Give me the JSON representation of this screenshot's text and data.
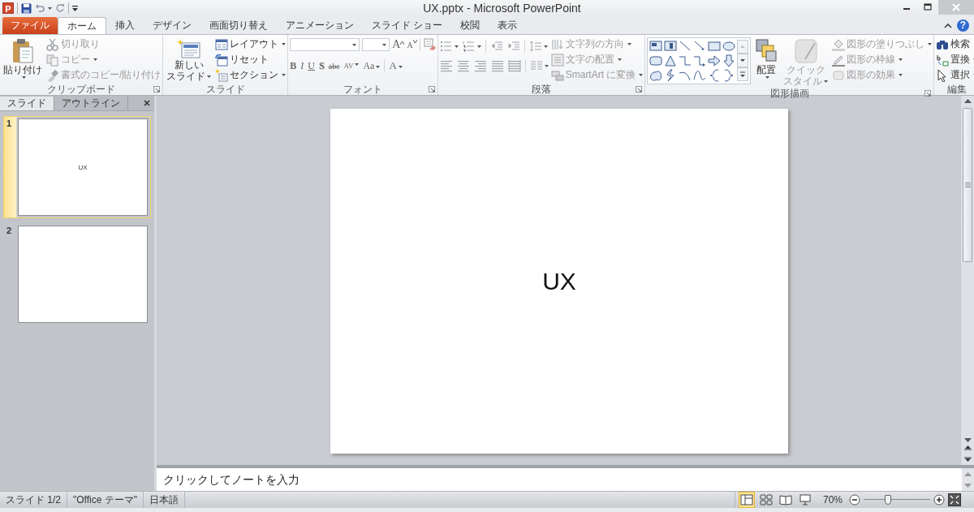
{
  "app_icon": {
    "letter": "P"
  },
  "window": {
    "title": "UX.pptx - Microsoft PowerPoint"
  },
  "tabs": [
    {
      "label": "ファイル",
      "kind": "file",
      "selected": false
    },
    {
      "label": "ホーム",
      "kind": "tab",
      "selected": true
    },
    {
      "label": "挿入",
      "kind": "tab",
      "selected": false
    },
    {
      "label": "デザイン",
      "kind": "tab",
      "selected": false
    },
    {
      "label": "画面切り替え",
      "kind": "tab",
      "selected": false
    },
    {
      "label": "アニメーション",
      "kind": "tab",
      "selected": false
    },
    {
      "label": "スライド ショー",
      "kind": "tab",
      "selected": false
    },
    {
      "label": "校閲",
      "kind": "tab",
      "selected": false
    },
    {
      "label": "表示",
      "kind": "tab",
      "selected": false
    }
  ],
  "help": "?",
  "ribbon": {
    "clipboard": {
      "label": "クリップボード",
      "paste": {
        "label": "貼り付け",
        "dropdown": true
      },
      "items": [
        {
          "label": "切り取り",
          "disabled": true,
          "dropdown": false
        },
        {
          "label": "コピー",
          "disabled": true,
          "dropdown": true
        },
        {
          "label": "書式のコピー/貼り付け",
          "disabled": true,
          "dropdown": false
        }
      ]
    },
    "slides": {
      "label": "スライド",
      "new_slide": {
        "lines": [
          "新しい",
          "スライド"
        ],
        "dropdown": true
      },
      "items": [
        {
          "label": "レイアウト",
          "disabled": false,
          "dropdown": true
        },
        {
          "label": "リセット",
          "disabled": false,
          "dropdown": false
        },
        {
          "label": "セクション",
          "disabled": false,
          "dropdown": true
        }
      ]
    },
    "font": {
      "label": "フォント",
      "size_buttons": [
        {
          "label": "A",
          "kind": "grow"
        },
        {
          "label": "A",
          "kind": "shrink"
        }
      ],
      "format_buttons": [
        {
          "label": "B",
          "kind": "bold",
          "dropdown": false
        },
        {
          "label": "I",
          "kind": "italic",
          "dropdown": false
        },
        {
          "label": "U",
          "kind": "underline",
          "dropdown": false
        },
        {
          "label": "S",
          "kind": "shadow",
          "dropdown": false
        },
        {
          "label": "abc",
          "kind": "strike",
          "dropdown": false
        },
        {
          "label": "AV",
          "kind": "spacing",
          "dropdown": true
        },
        {
          "label": "Aa",
          "kind": "case",
          "dropdown": true
        },
        {
          "label": "A",
          "kind": "color",
          "dropdown": true
        }
      ]
    },
    "paragraph": {
      "label": "段落",
      "items": [
        {
          "label": "文字列の方向",
          "disabled": true,
          "dropdown": true
        },
        {
          "label": "文字の配置",
          "disabled": true,
          "dropdown": true
        },
        {
          "label": "SmartArt に変換",
          "disabled": true,
          "dropdown": true
        }
      ]
    },
    "drawing": {
      "label": "図形描画",
      "arrange": {
        "label": "配置",
        "dropdown": true
      },
      "quick_style": {
        "lines": [
          "クイック",
          "スタイル"
        ],
        "disabled": true,
        "dropdown": true
      },
      "items": [
        {
          "label": "図形の塗りつぶし",
          "disabled": true,
          "dropdown": true
        },
        {
          "label": "図形の枠線",
          "disabled": true,
          "dropdown": true
        },
        {
          "label": "図形の効果",
          "disabled": true,
          "dropdown": true
        }
      ]
    },
    "editing": {
      "label": "編集",
      "items": [
        {
          "label": "検索",
          "disabled": false,
          "dropdown": false
        },
        {
          "label": "置換",
          "disabled": false,
          "dropdown": true
        },
        {
          "label": "選択",
          "disabled": false,
          "dropdown": true
        }
      ]
    }
  },
  "panel": {
    "tabs": [
      {
        "label": "スライド",
        "selected": true
      },
      {
        "label": "アウトライン",
        "selected": false
      }
    ],
    "slides": [
      {
        "number": "1",
        "text": "UX",
        "selected": true
      },
      {
        "number": "2",
        "selected": false
      }
    ]
  },
  "slide": {
    "text": "UX"
  },
  "notes": {
    "placeholder": "クリックしてノートを入力"
  },
  "status_bar": {
    "items": [
      "スライド 1/2",
      "\"Office テーマ\"",
      "日本語"
    ],
    "views": [
      {
        "selected": true
      },
      {
        "selected": false
      },
      {
        "selected": false
      },
      {
        "selected": false
      }
    ],
    "zoom": "70%",
    "zoom_slider": {
      "level": 0.37
    }
  }
}
